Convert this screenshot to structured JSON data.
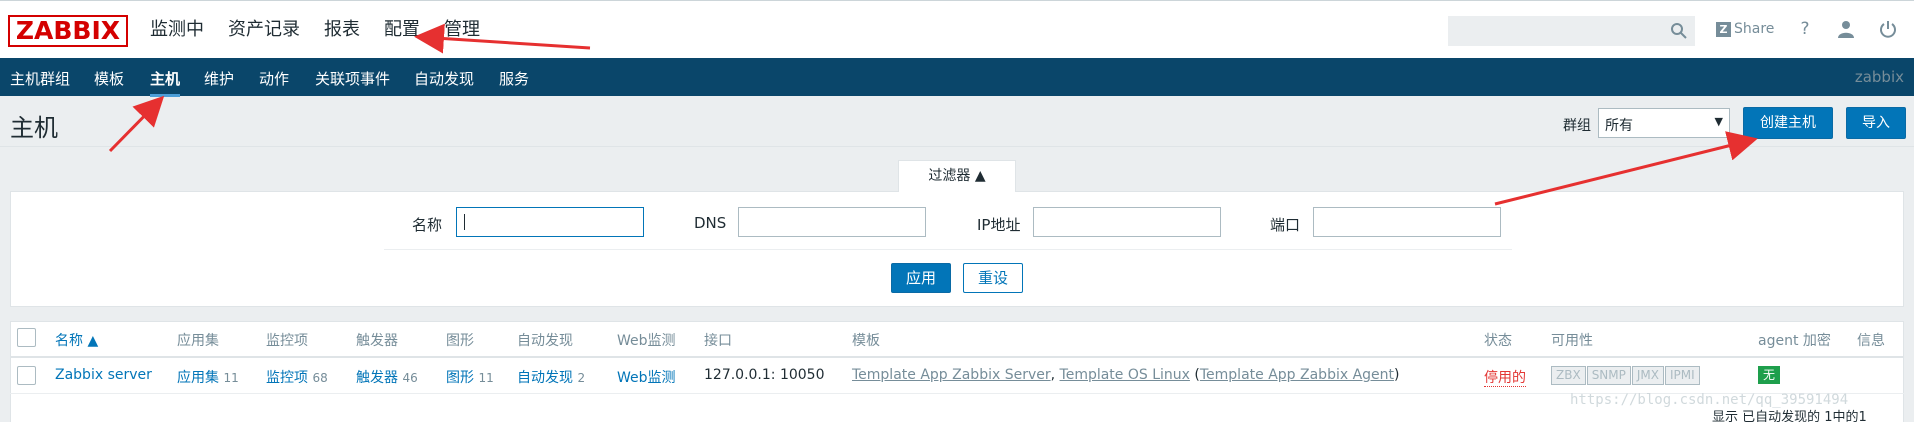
{
  "header": {
    "logo": "ZABBIX",
    "main_nav": [
      "监测中",
      "资产记录",
      "报表",
      "配置",
      "管理"
    ],
    "active_main": "配置",
    "search_placeholder": "",
    "share_label": "Share",
    "help_label": "?",
    "icons": [
      "search-icon",
      "help-icon",
      "user-icon",
      "power-icon"
    ]
  },
  "subnav": {
    "items": [
      "主机群组",
      "模板",
      "主机",
      "维护",
      "动作",
      "关联项事件",
      "自动发现",
      "服务"
    ],
    "active": "主机",
    "brand": "zabbix"
  },
  "page": {
    "title": "主机",
    "group_label": "群组",
    "group_value": "所有",
    "create_button": "创建主机",
    "import_button": "导入"
  },
  "filter": {
    "tab_label": "过滤器 ▲",
    "name_label": "名称",
    "dns_label": "DNS",
    "ip_label": "IP地址",
    "port_label": "端口",
    "name_value": "",
    "dns_value": "",
    "ip_value": "",
    "port_value": "",
    "apply_button": "应用",
    "reset_button": "重设"
  },
  "table": {
    "columns": [
      "名称 ▲",
      "应用集",
      "监控项",
      "触发器",
      "图形",
      "自动发现",
      "Web监测",
      "接口",
      "模板",
      "状态",
      "可用性",
      "agent 加密",
      "信息"
    ],
    "rows": [
      {
        "name": "Zabbix server",
        "applications": "应用集",
        "applications_count": "11",
        "items": "监控项",
        "items_count": "68",
        "triggers": "触发器",
        "triggers_count": "46",
        "graphs": "图形",
        "graphs_count": "11",
        "discovery": "自动发现",
        "discovery_count": "2",
        "web": "Web监测",
        "interface": "127.0.0.1: 10050",
        "template_1": "Template App Zabbix Server",
        "template_sep": ", ",
        "template_2": "Template OS Linux",
        "template_open": " (",
        "template_3": "Template App Zabbix Agent",
        "template_close": ")",
        "status": "停用的",
        "availability": [
          "ZBX",
          "SNMP",
          "JMX",
          "IPMI"
        ],
        "encryption": "无"
      }
    ],
    "footer": "显示 已自动发现的 1中的1"
  },
  "watermark": "https://blog.csdn.net/qq_39591494",
  "colors": {
    "brand_red": "#d40000",
    "nav_bg": "#0a466a",
    "accent": "#0275b8",
    "status_red": "#e33734",
    "badge_green": "#1e9f4c",
    "arrow_red": "#e63030"
  }
}
